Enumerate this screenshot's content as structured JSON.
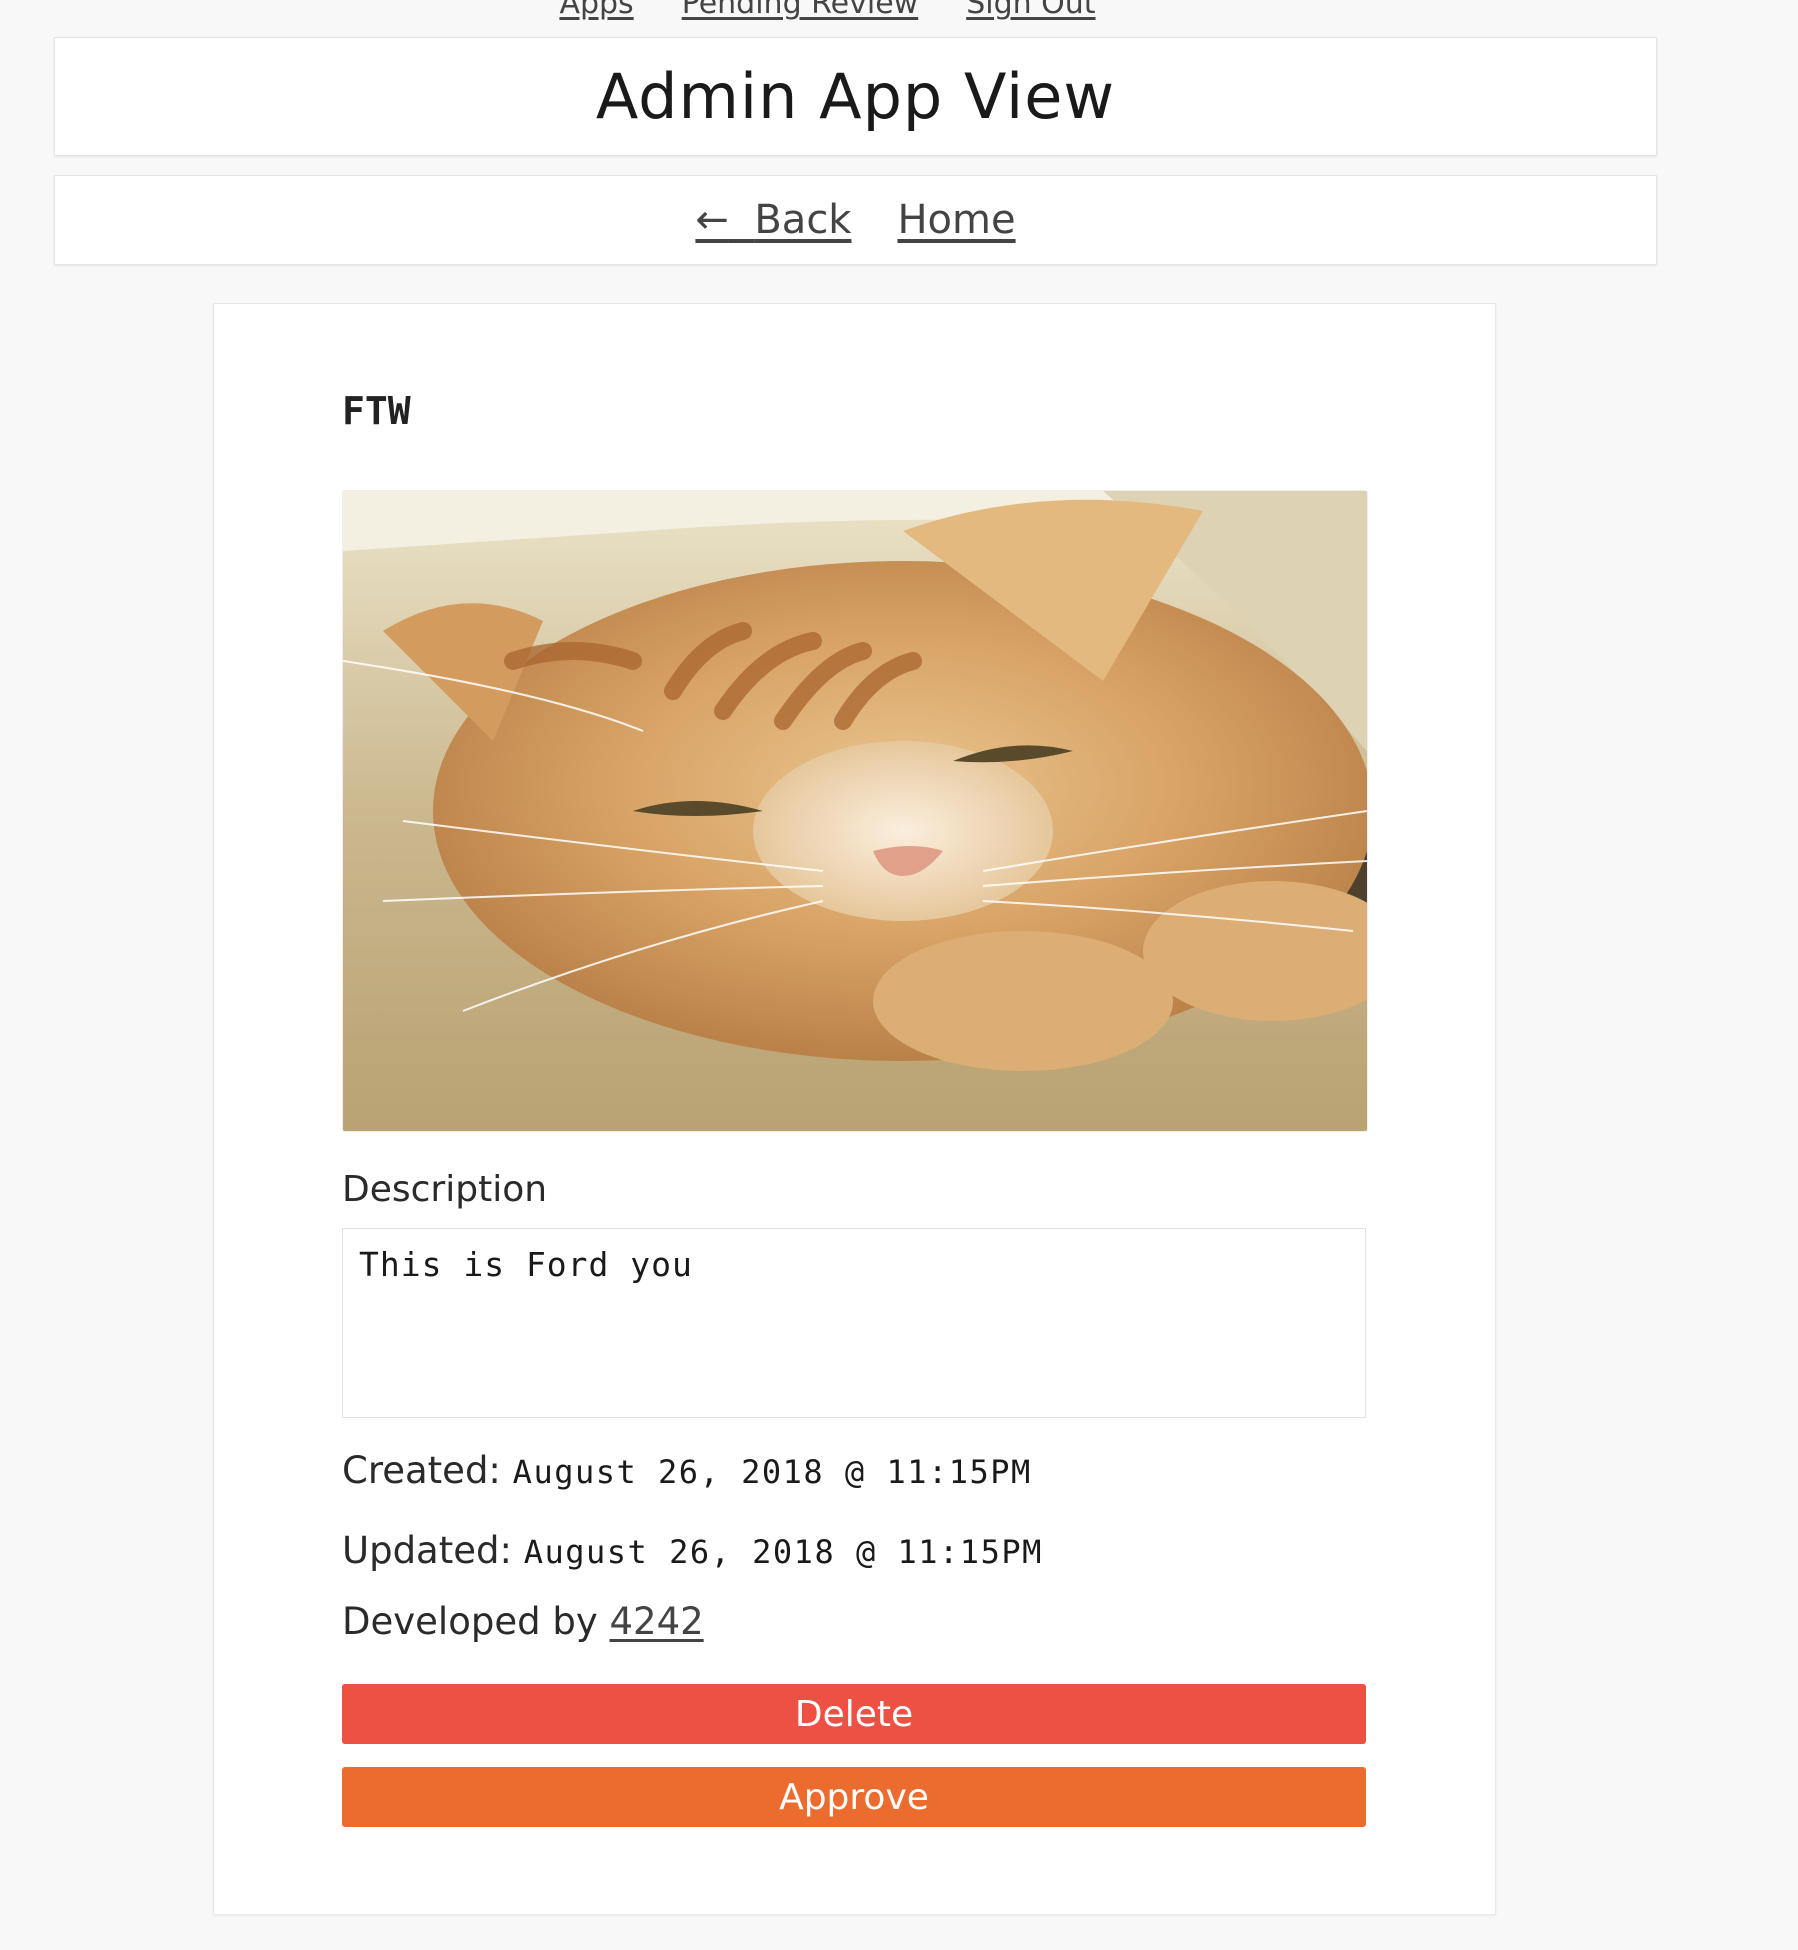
{
  "top_nav": {
    "links": [
      "Apps",
      "Pending Review",
      "Sign Out"
    ]
  },
  "header": {
    "title": "Admin App View"
  },
  "nav": {
    "back_arrow": "←",
    "back_label": "Back",
    "home_label": "Home"
  },
  "app": {
    "name": "FTW",
    "image_alt": "orange tabby cat",
    "description_label": "Description",
    "description": "This is Ford you",
    "created_label": "Created:",
    "created_value": "August 26, 2018 @ 11:15PM",
    "updated_label": "Updated:",
    "updated_value": "August 26, 2018 @ 11:15PM",
    "developed_by_label": "Developed by",
    "developer": "4242"
  },
  "actions": {
    "delete_label": "Delete",
    "approve_label": "Approve"
  },
  "colors": {
    "delete": "#ec5144",
    "approve": "#ec6c30",
    "background": "#f8f8f8"
  }
}
